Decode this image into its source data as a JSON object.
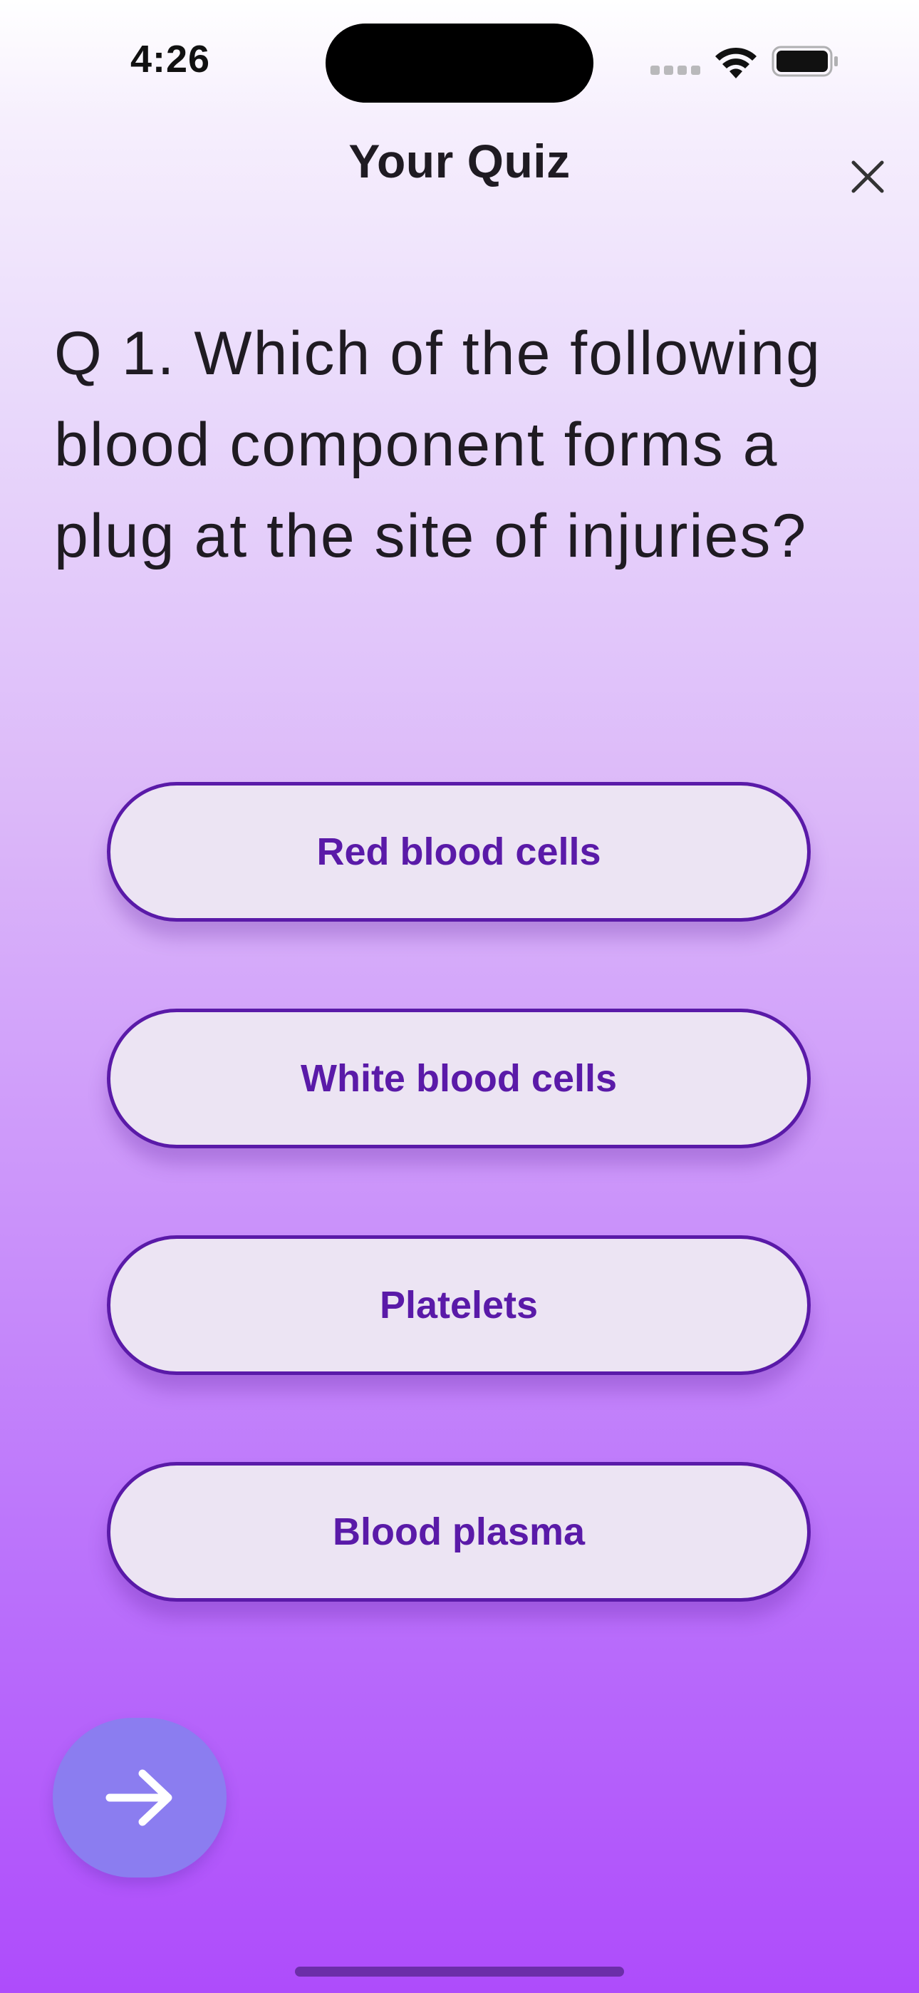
{
  "status_bar": {
    "time": "4:26"
  },
  "header": {
    "title": "Your Quiz",
    "close_icon": "close-icon"
  },
  "question": {
    "text": "Q 1. Which of the following blood component forms a plug at the site of injuries?"
  },
  "options": [
    {
      "label": "Red blood cells"
    },
    {
      "label": "White blood cells"
    },
    {
      "label": "Platelets"
    },
    {
      "label": "Blood plasma"
    }
  ],
  "next_button": {
    "icon": "arrow-right-icon"
  },
  "colors": {
    "accent": "#5a1aa8",
    "option_background": "#ece4f3",
    "fab_background": "#8b7df0",
    "gradient_top": "#ffffff",
    "gradient_bottom": "#ae4cfb"
  }
}
